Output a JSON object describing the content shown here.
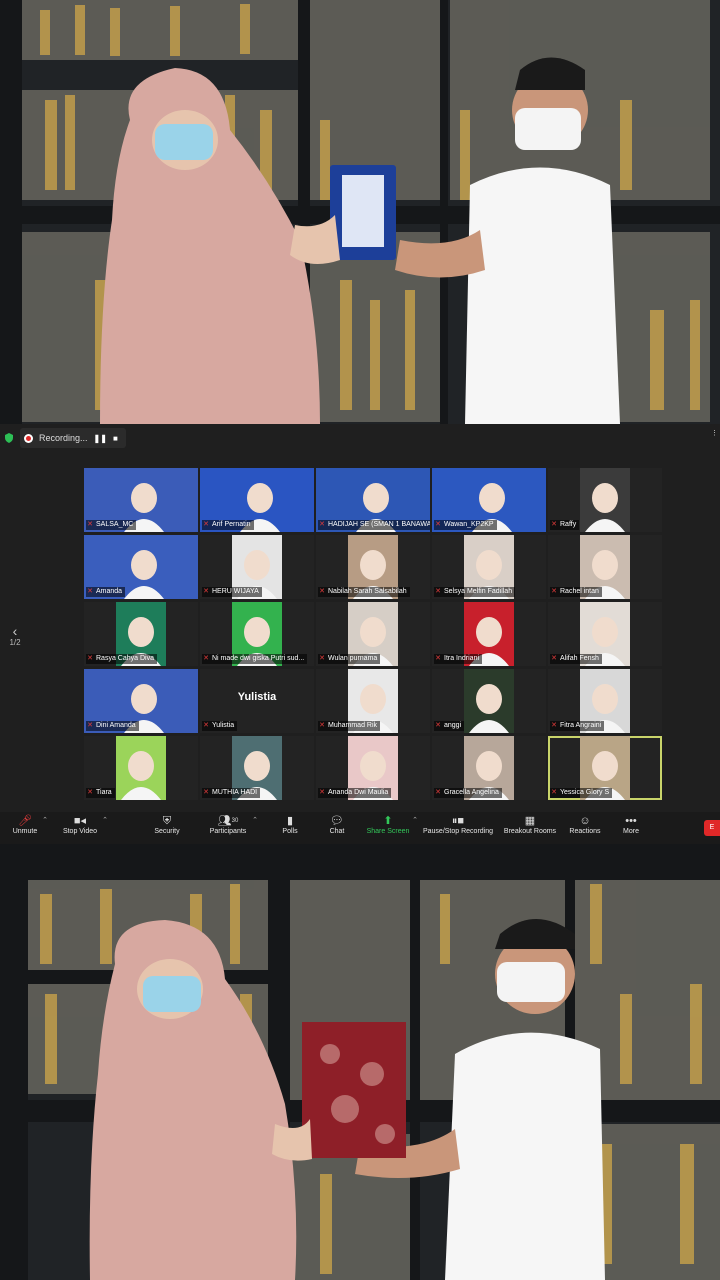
{
  "recording": {
    "label": "Recording...",
    "pause_glyph": "❚❚",
    "stop_glyph": "■"
  },
  "pager": {
    "page": "1/2",
    "arrow": "‹"
  },
  "participants": [
    {
      "name": "SALSA_MC",
      "muted": true,
      "bg": "#3b5cb8"
    },
    {
      "name": "Arif Pernatin",
      "muted": true,
      "bg": "#2a55c2"
    },
    {
      "name": "HADIJAH SE (SMAN 1 BANAWA)",
      "muted": true,
      "bg": "#2d57b5"
    },
    {
      "name": "Wawan_KP2KP",
      "muted": true,
      "bg": "#2c58c0"
    },
    {
      "name": "Raffy",
      "muted": true,
      "bg": "#3b3b3b"
    },
    {
      "name": "Amanda",
      "muted": true,
      "bg": "#3a5ebd"
    },
    {
      "name": "HERU WIJAYA",
      "muted": true,
      "bg": "#e4e4e4"
    },
    {
      "name": "Nabilah Sarah Salsabilah",
      "muted": true,
      "bg": "#b79c84"
    },
    {
      "name": "Selsya Melfin Fadillah",
      "muted": true,
      "bg": "#d9cfc7"
    },
    {
      "name": "Rachel intan",
      "muted": true,
      "bg": "#cbbcb0"
    },
    {
      "name": "Rasya Cahya Diva",
      "muted": true,
      "bg": "#1e7d5a"
    },
    {
      "name": "Ni made dwi giska Putri sud...",
      "muted": true,
      "bg": "#33b24e"
    },
    {
      "name": "Wulan purnama",
      "muted": true,
      "bg": "#d6cec6"
    },
    {
      "name": "Itra Indriani",
      "muted": true,
      "bg": "#c8202c"
    },
    {
      "name": "Alifah Fensh",
      "muted": true,
      "bg": "#e2dcd6"
    },
    {
      "name": "Dini Amanda",
      "muted": true,
      "bg": "#3b5cb8"
    },
    {
      "name": "Yulistia",
      "muted": true,
      "bg": "#232323",
      "display": "Yulistia"
    },
    {
      "name": "Muhammad Rik",
      "muted": true,
      "bg": "#e8e8e8"
    },
    {
      "name": "anggi",
      "muted": true,
      "bg": "#2b3b2b"
    },
    {
      "name": "Fitra Angraini",
      "muted": true,
      "bg": "#d8d8d8"
    },
    {
      "name": "Tiara",
      "muted": true,
      "bg": "#9bd45a"
    },
    {
      "name": "MUTHIA HADI",
      "muted": true,
      "bg": "#4e6e72"
    },
    {
      "name": "Ananda Dwi Maulia",
      "muted": true,
      "bg": "#e9c8c8"
    },
    {
      "name": "Gracella Angelina",
      "muted": true,
      "bg": "#b7a79a"
    },
    {
      "name": "Yessica Glory S",
      "muted": true,
      "bg": "#b9a586",
      "active": true
    }
  ],
  "toolbar": {
    "unmute": "Unmute",
    "stop_video": "Stop Video",
    "security": "Security",
    "participants": "Participants",
    "participants_count": "30",
    "polls": "Polls",
    "chat": "Chat",
    "share_screen": "Share Screen",
    "pause_stop_recording": "Pause/Stop Recording",
    "breakout_rooms": "Breakout Rooms",
    "reactions": "Reactions",
    "more": "More",
    "end": "E"
  },
  "colors": {
    "share_green": "#33c85a",
    "mute_red": "#e23b3b",
    "end_red": "#e02828",
    "active_speaker": "#c9d46a"
  }
}
